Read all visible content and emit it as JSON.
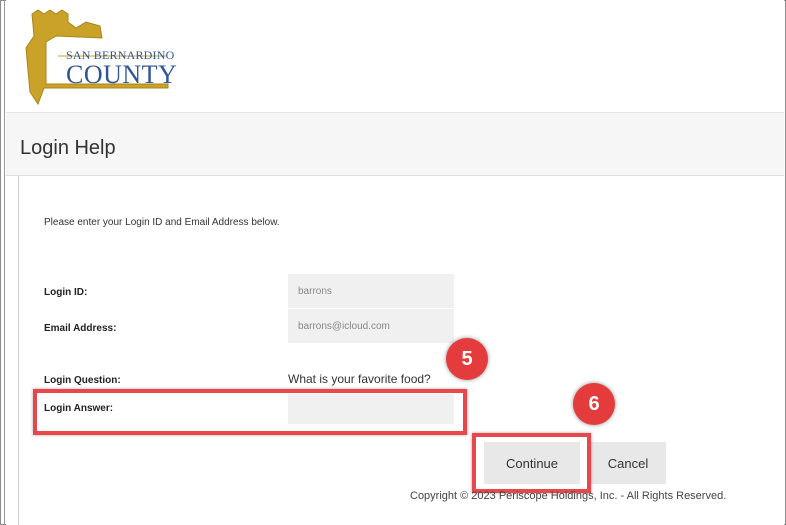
{
  "header": {
    "logo_line1": "SAN BERNARDINO",
    "logo_line2": "COUNTY",
    "logo_color": "#2f5597",
    "shield_color": "#c9a227"
  },
  "page": {
    "title": "Login Help",
    "instructions": "Please enter your Login ID and Email Address below."
  },
  "form": {
    "login_id_label": "Login ID:",
    "login_id_value": "barrons",
    "email_label": "Email Address:",
    "email_value": "barrons@icloud.com",
    "question_label": "Login Question:",
    "question_value": "What is your favorite food?",
    "answer_label": "Login Answer:",
    "answer_value": ""
  },
  "buttons": {
    "continue_label": "Continue",
    "cancel_label": "Cancel"
  },
  "annotations": {
    "step5": "5",
    "step6": "6",
    "highlight_color": "#e8484c"
  },
  "footer": {
    "copyright": "Copyright © 2023 Periscope Holdings, Inc. - All Rights Reserved."
  }
}
